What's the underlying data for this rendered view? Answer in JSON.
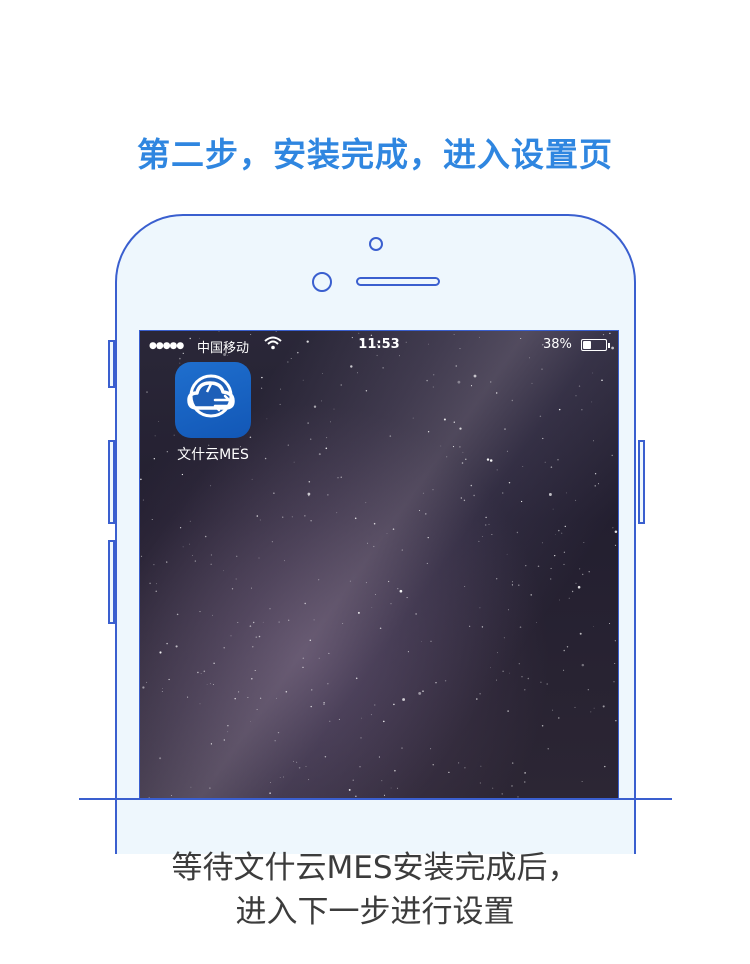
{
  "title": "第二步，安装完成，进入设置页",
  "status_bar": {
    "signal": "●●●●●",
    "carrier": "中国移动",
    "time": "11:53",
    "battery_text": "38%",
    "battery_level": 0.38
  },
  "app": {
    "name": "文什云MES",
    "icon": "cloud-sync-icon",
    "icon_color": "#1a62c2"
  },
  "description": {
    "line1": "等待文什云MES安装完成后，",
    "line2": "进入下一步进行设置"
  },
  "colors": {
    "accent": "#2f86e0",
    "outline": "#3a5fcf"
  }
}
